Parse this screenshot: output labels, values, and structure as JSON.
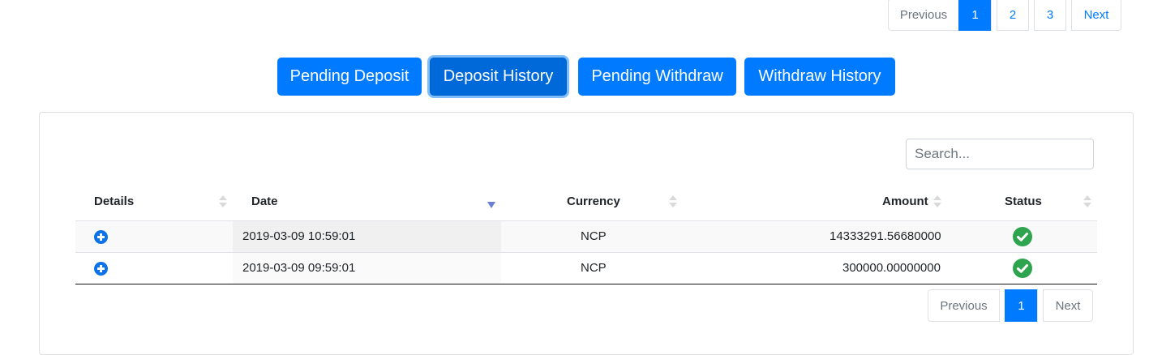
{
  "top_pagination": {
    "previous": "Previous",
    "pages": [
      "1",
      "2",
      "3"
    ],
    "active_page": "1",
    "next": "Next"
  },
  "tabs": [
    {
      "label": "Pending Deposit"
    },
    {
      "label": "Deposit History",
      "focused": true
    },
    {
      "label": "Pending Withdraw"
    },
    {
      "label": "Withdraw History"
    }
  ],
  "search": {
    "placeholder": "Search...",
    "value": ""
  },
  "table": {
    "columns": [
      "Details",
      "Date",
      "Currency",
      "Amount",
      "Status"
    ],
    "sorted_column": "Date",
    "sort_direction": "descending",
    "rows": [
      {
        "date": "2019-03-09 10:59:01",
        "currency": "NCP",
        "amount": "14333291.56680000",
        "status": "completed"
      },
      {
        "date": "2019-03-09 09:59:01",
        "currency": "NCP",
        "amount": "300000.00000000",
        "status": "completed"
      }
    ]
  },
  "bottom_pagination": {
    "previous": "Previous",
    "pages": [
      "1"
    ],
    "active_page": "1",
    "next": "Next"
  },
  "colors": {
    "primary": "#007bff",
    "status_success": "#2ea44f",
    "details_icon": "#0b72e7",
    "sort_active": "#6b7fd7"
  },
  "icons": {
    "details": "plus-circle-icon",
    "status": "check-circle-icon",
    "sort": "sort-icon"
  }
}
